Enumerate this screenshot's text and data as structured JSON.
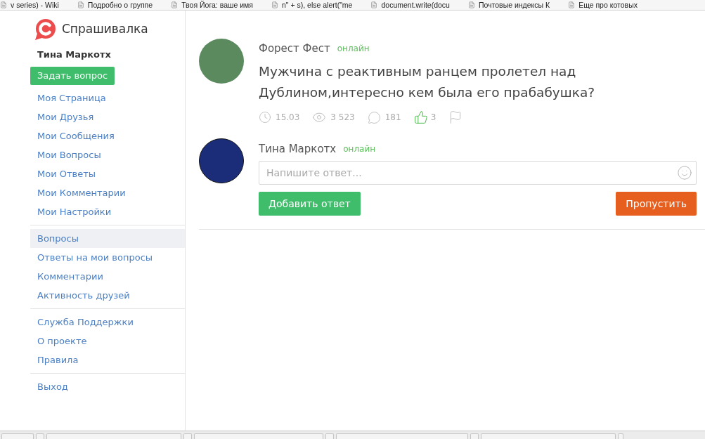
{
  "bookmarks": [
    "v series) - Wiki",
    "Подробно о группе",
    "Твоя Йога: ваше имя",
    "n\" + s), else alert(\"me",
    "document.write(docu",
    "Почтовые индексы К",
    "Еще про котовых"
  ],
  "sidebar": {
    "logo_text": "Спрашивалка",
    "user_name": "Тина Маркотх",
    "ask_button": "Задать вопрос",
    "menu_groups": [
      {
        "items": [
          {
            "label": "Моя Страница",
            "selected": false
          },
          {
            "label": "Мои Друзья",
            "selected": false
          },
          {
            "label": "Мои Сообщения",
            "selected": false
          },
          {
            "label": "Мои Вопросы",
            "selected": false
          },
          {
            "label": "Мои Ответы",
            "selected": false
          },
          {
            "label": "Мои Комментарии",
            "selected": false
          },
          {
            "label": "Мои Настройки",
            "selected": false
          }
        ]
      },
      {
        "items": [
          {
            "label": "Вопросы",
            "selected": true
          },
          {
            "label": "Ответы на мои вопросы",
            "selected": false
          },
          {
            "label": "Комментарии",
            "selected": false
          },
          {
            "label": "Активность друзей",
            "selected": false
          }
        ]
      },
      {
        "items": [
          {
            "label": "Служба Поддержки",
            "selected": false
          },
          {
            "label": "О проекте",
            "selected": false
          },
          {
            "label": "Правила",
            "selected": false
          }
        ]
      },
      {
        "items": [
          {
            "label": "Выход",
            "selected": false
          }
        ]
      }
    ]
  },
  "question": {
    "author": "Форест Фест",
    "author_status": "онлайн",
    "text": "Мужчина с реактивным ранцем пролетел над Дублином,интересно кем была его прабабушка?",
    "stats": {
      "date": "15.03",
      "views": "3 523",
      "comments": "181",
      "likes": "3"
    }
  },
  "answer_form": {
    "user": "Тина Маркотх",
    "user_status": "онлайн",
    "placeholder": "Напишите ответ...",
    "submit_button": "Добавить ответ",
    "skip_button": "Пропустить"
  }
}
